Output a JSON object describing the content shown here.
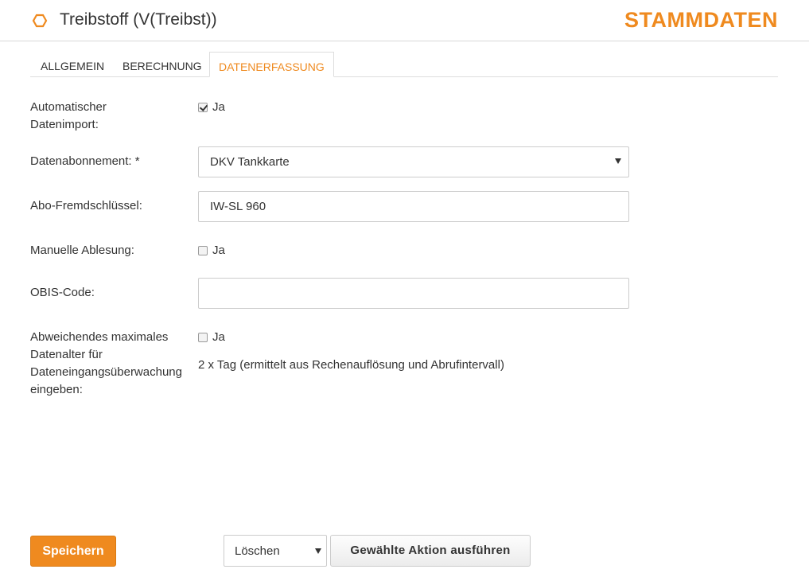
{
  "header": {
    "icon": "hexagon-icon",
    "title": "Treibstoff (V(Treibst))",
    "section": "STAMMDATEN",
    "accent_color": "#ef8a1f"
  },
  "tabs": [
    {
      "label": "ALLGEMEIN",
      "active": false
    },
    {
      "label": "BERECHNUNG",
      "active": false
    },
    {
      "label": "DATENERFASSUNG",
      "active": true
    }
  ],
  "form": {
    "auto_import": {
      "label_line1": "Automatischer",
      "label_line2": "Datenimport:",
      "checked": true,
      "option": "Ja"
    },
    "subscription": {
      "label": "Datenabonnement: *",
      "value": "DKV Tankkarte"
    },
    "foreign_key": {
      "label": "Abo-Fremdschlüssel:",
      "value": "IW-SL 960"
    },
    "manual_reading": {
      "label": "Manuelle Ablesung:",
      "checked": false,
      "option": "Ja"
    },
    "obis": {
      "label": "OBIS-Code:",
      "value": ""
    },
    "max_age": {
      "label_line1": "Abweichendes maximales",
      "label_line2": "Datenalter für",
      "label_line3": "Dateneingangsüberwachung",
      "label_line4": "eingeben:",
      "checked": false,
      "option": "Ja",
      "info": "2 x Tag (ermittelt aus Rechenauflösung und Abrufintervall)"
    }
  },
  "footer": {
    "save_label": "Speichern",
    "action_value": "Löschen",
    "execute_label": "Gewählte Aktion ausführen"
  }
}
